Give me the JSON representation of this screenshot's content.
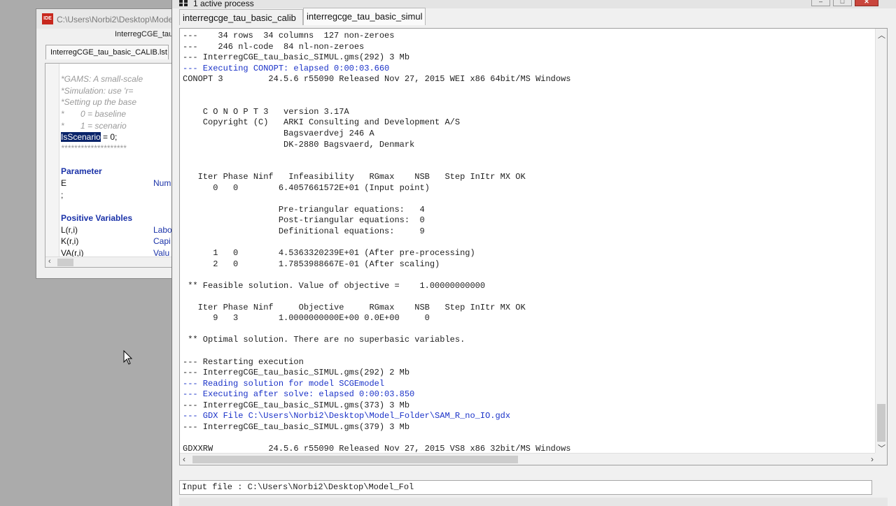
{
  "ide": {
    "title": "C:\\Users\\Norbi2\\Desktop\\Mode",
    "logo": "IDE",
    "subtitle": "InterregCGE_tau_",
    "file_tab": "InterregCGE_tau_basic_CALIB.lst",
    "code": [
      {
        "text": "*GAMS: A small-scale",
        "kind": "comment"
      },
      {
        "text": "*Simulation: use 'r=",
        "kind": "comment"
      },
      {
        "text": "*Setting up the base",
        "kind": "comment"
      },
      {
        "text": "*       0 = baseline",
        "kind": "comment"
      },
      {
        "text": "*       1 = scenario",
        "kind": "comment"
      },
      {
        "text": "********************",
        "kind": "comment"
      },
      {
        "text": "Parameter",
        "kind": "kw"
      },
      {
        "text": ";",
        "kind": "id"
      },
      {
        "text": "Positive Variables",
        "kind": "kw"
      }
    ],
    "scenario_line": {
      "ident": "IsScenario",
      "rest": " = 0;"
    },
    "param_decl": {
      "ident": "E",
      "desc": "Numb"
    },
    "variables": [
      {
        "ident": "L(r,i)",
        "desc": "Labo"
      },
      {
        "ident": "K(r,i)",
        "desc": "Capi"
      },
      {
        "ident": "VA(r,i)",
        "desc": "Valu"
      }
    ]
  },
  "process": {
    "title": "1 active process",
    "tabs": [
      {
        "label": "interregcge_tau_basic_calib",
        "active": false
      },
      {
        "label": "interregcge_tau_basic_simul",
        "active": true
      }
    ],
    "buttons": {
      "minimize": "–",
      "maximize": "□",
      "close": "✕"
    },
    "log": [
      {
        "text": "---    34 rows  34 columns  127 non-zeroes",
        "blue": false
      },
      {
        "text": "---    246 nl-code  84 nl-non-zeroes",
        "blue": false
      },
      {
        "text": "--- InterregCGE_tau_basic_SIMUL.gms(292) 3 Mb",
        "blue": false
      },
      {
        "text": "--- Executing CONOPT: elapsed 0:00:03.660",
        "blue": true
      },
      {
        "text": "CONOPT 3         24.5.6 r55090 Released Nov 27, 2015 WEI x86 64bit/MS Windows",
        "blue": false
      },
      {
        "text": "",
        "blue": false
      },
      {
        "text": "",
        "blue": false
      },
      {
        "text": "    C O N O P T 3   version 3.17A",
        "blue": false
      },
      {
        "text": "    Copyright (C)   ARKI Consulting and Development A/S",
        "blue": false
      },
      {
        "text": "                    Bagsvaerdvej 246 A",
        "blue": false
      },
      {
        "text": "                    DK-2880 Bagsvaerd, Denmark",
        "blue": false
      },
      {
        "text": "",
        "blue": false
      },
      {
        "text": "",
        "blue": false
      },
      {
        "text": "   Iter Phase Ninf   Infeasibility   RGmax    NSB   Step InItr MX OK",
        "blue": false
      },
      {
        "text": "      0   0        6.4057661572E+01 (Input point)",
        "blue": false
      },
      {
        "text": "",
        "blue": false
      },
      {
        "text": "                   Pre-triangular equations:   4",
        "blue": false
      },
      {
        "text": "                   Post-triangular equations:  0",
        "blue": false
      },
      {
        "text": "                   Definitional equations:     9",
        "blue": false
      },
      {
        "text": "",
        "blue": false
      },
      {
        "text": "      1   0        4.5363320239E+01 (After pre-processing)",
        "blue": false
      },
      {
        "text": "      2   0        1.7853988667E-01 (After scaling)",
        "blue": false
      },
      {
        "text": "",
        "blue": false
      },
      {
        "text": " ** Feasible solution. Value of objective =    1.00000000000",
        "blue": false
      },
      {
        "text": "",
        "blue": false
      },
      {
        "text": "   Iter Phase Ninf     Objective     RGmax    NSB   Step InItr MX OK",
        "blue": false
      },
      {
        "text": "      9   3        1.0000000000E+00 0.0E+00     0",
        "blue": false
      },
      {
        "text": "",
        "blue": false
      },
      {
        "text": " ** Optimal solution. There are no superbasic variables.",
        "blue": false
      },
      {
        "text": "",
        "blue": false
      },
      {
        "text": "--- Restarting execution",
        "blue": false
      },
      {
        "text": "--- InterregCGE_tau_basic_SIMUL.gms(292) 2 Mb",
        "blue": false
      },
      {
        "text": "--- Reading solution for model SCGEmodel",
        "blue": true
      },
      {
        "text": "--- Executing after solve: elapsed 0:00:03.850",
        "blue": true
      },
      {
        "text": "--- InterregCGE_tau_basic_SIMUL.gms(373) 3 Mb",
        "blue": false
      },
      {
        "text": "--- GDX File C:\\Users\\Norbi2\\Desktop\\Model_Folder\\SAM_R_no_IO.gdx",
        "blue": true
      },
      {
        "text": "--- InterregCGE_tau_basic_SIMUL.gms(379) 3 Mb",
        "blue": false
      },
      {
        "text": "",
        "blue": false
      },
      {
        "text": "GDXXRW           24.5.6 r55090 Released Nov 27, 2015 VS8 x86 32bit/MS Windows",
        "blue": false
      }
    ],
    "input_line": "Input file : C:\\Users\\Norbi2\\Desktop\\Model_Fol",
    "scroll_position": 0.93
  },
  "icons": [
    "ide-logo-icon",
    "window-menu-icon",
    "mouse-cursor-icon"
  ],
  "colors": {
    "log_blue": "#1a32c8",
    "keyword_blue": "#1a32a8",
    "selection": "#0a246a",
    "close_red": "#c9463d"
  }
}
